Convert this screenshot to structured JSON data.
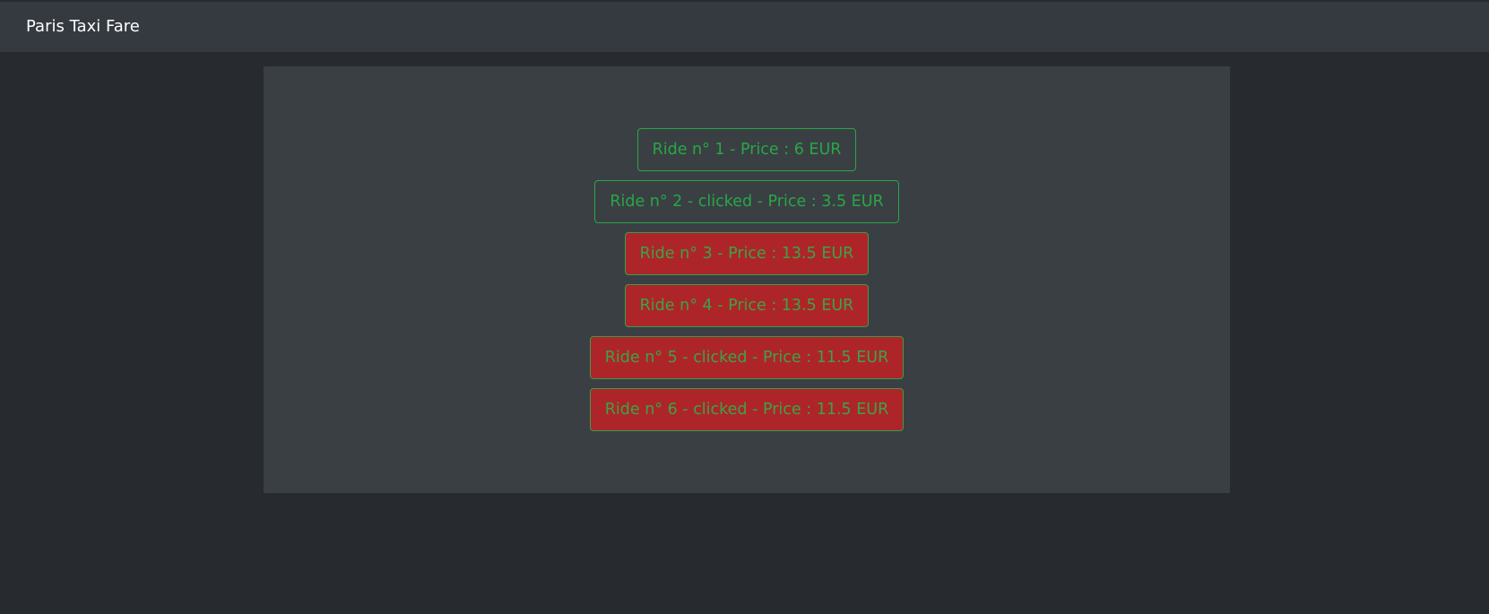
{
  "navbar": {
    "brand": "Paris Taxi Fare"
  },
  "rides": [
    {
      "label": "Ride n° 1 - Price : 6 EUR",
      "status": "normal"
    },
    {
      "label": "Ride n° 2 - clicked - Price : 3.5 EUR",
      "status": "normal"
    },
    {
      "label": "Ride n° 3 - Price : 13.5 EUR",
      "status": "expensive"
    },
    {
      "label": "Ride n° 4 - Price : 13.5 EUR",
      "status": "expensive"
    },
    {
      "label": "Ride n° 5 - clicked - Price : 11.5 EUR",
      "status": "expensive"
    },
    {
      "label": "Ride n° 6 - clicked - Price : 11.5 EUR",
      "status": "expensive"
    }
  ],
  "colors": {
    "background": "#272b30",
    "navbar": "#353a41",
    "panel": "#3a3f44",
    "success_green": "#28a745",
    "danger_red": "#ad2529"
  }
}
